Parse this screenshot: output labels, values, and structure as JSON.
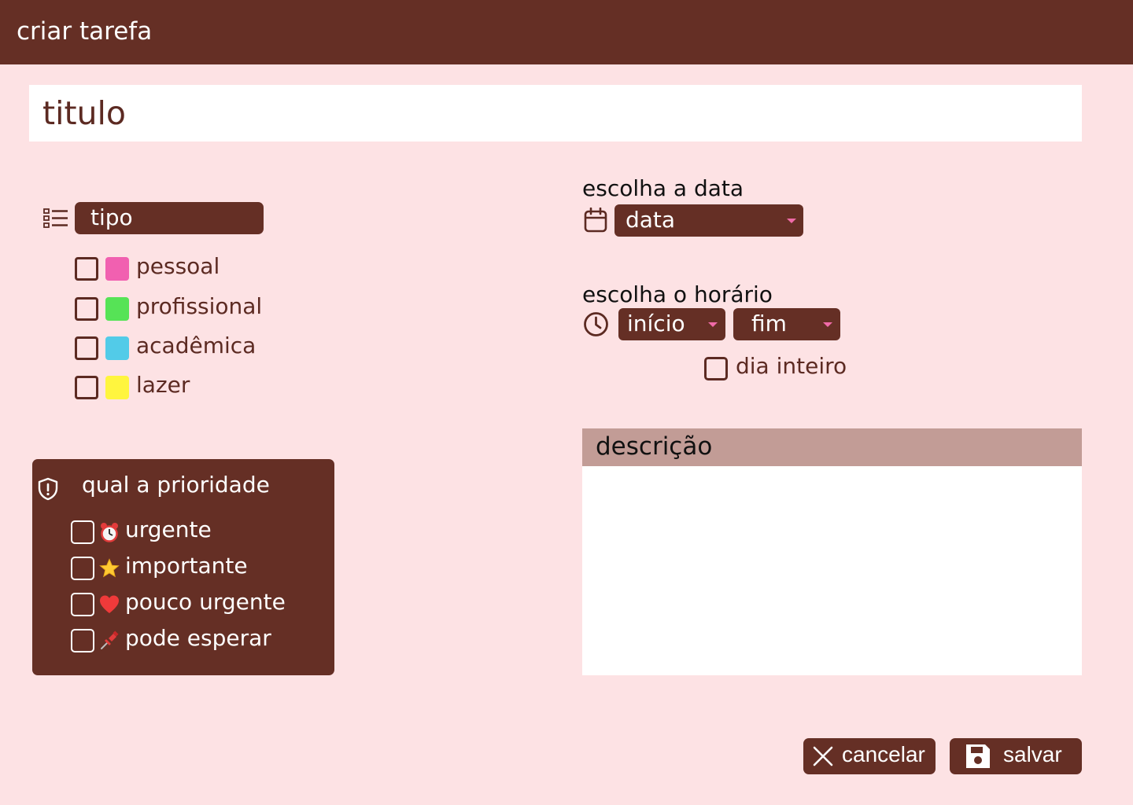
{
  "header": {
    "title": "criar tarefa"
  },
  "title_field": {
    "placeholder": "titulo",
    "value": ""
  },
  "type_section": {
    "label": "tipo",
    "icon": "list-icon",
    "options": [
      {
        "label": "pessoal",
        "color": "#f160b0",
        "checked": false
      },
      {
        "label": "profissional",
        "color": "#56e356",
        "checked": false
      },
      {
        "label": "acadêmica",
        "color": "#52cbe8",
        "checked": false
      },
      {
        "label": "lazer",
        "color": "#fff53e",
        "checked": false
      }
    ]
  },
  "priority_section": {
    "title": "qual a prioridade",
    "icon": "shield-icon",
    "options": [
      {
        "label": "urgente",
        "icon": "alarm-clock-icon",
        "checked": false
      },
      {
        "label": "importante",
        "icon": "star-icon",
        "checked": false
      },
      {
        "label": "pouco urgente",
        "icon": "heart-icon",
        "checked": false
      },
      {
        "label": "pode esperar",
        "icon": "pushpin-icon",
        "checked": false
      }
    ]
  },
  "date_section": {
    "label": "escolha a data",
    "icon": "calendar-icon",
    "selected": "data"
  },
  "time_section": {
    "label": "escolha o horário",
    "icon": "clock-icon",
    "start": "início",
    "end": "fim",
    "all_day_label": "dia inteiro",
    "all_day_checked": false
  },
  "description": {
    "header": "descrição",
    "value": ""
  },
  "actions": {
    "cancel_label": "cancelar",
    "save_label": "salvar"
  },
  "colors": {
    "primary": "#652f25",
    "background": "#fde2e4",
    "accent_caret": "#f06ba8",
    "description_header": "#c29c96"
  }
}
